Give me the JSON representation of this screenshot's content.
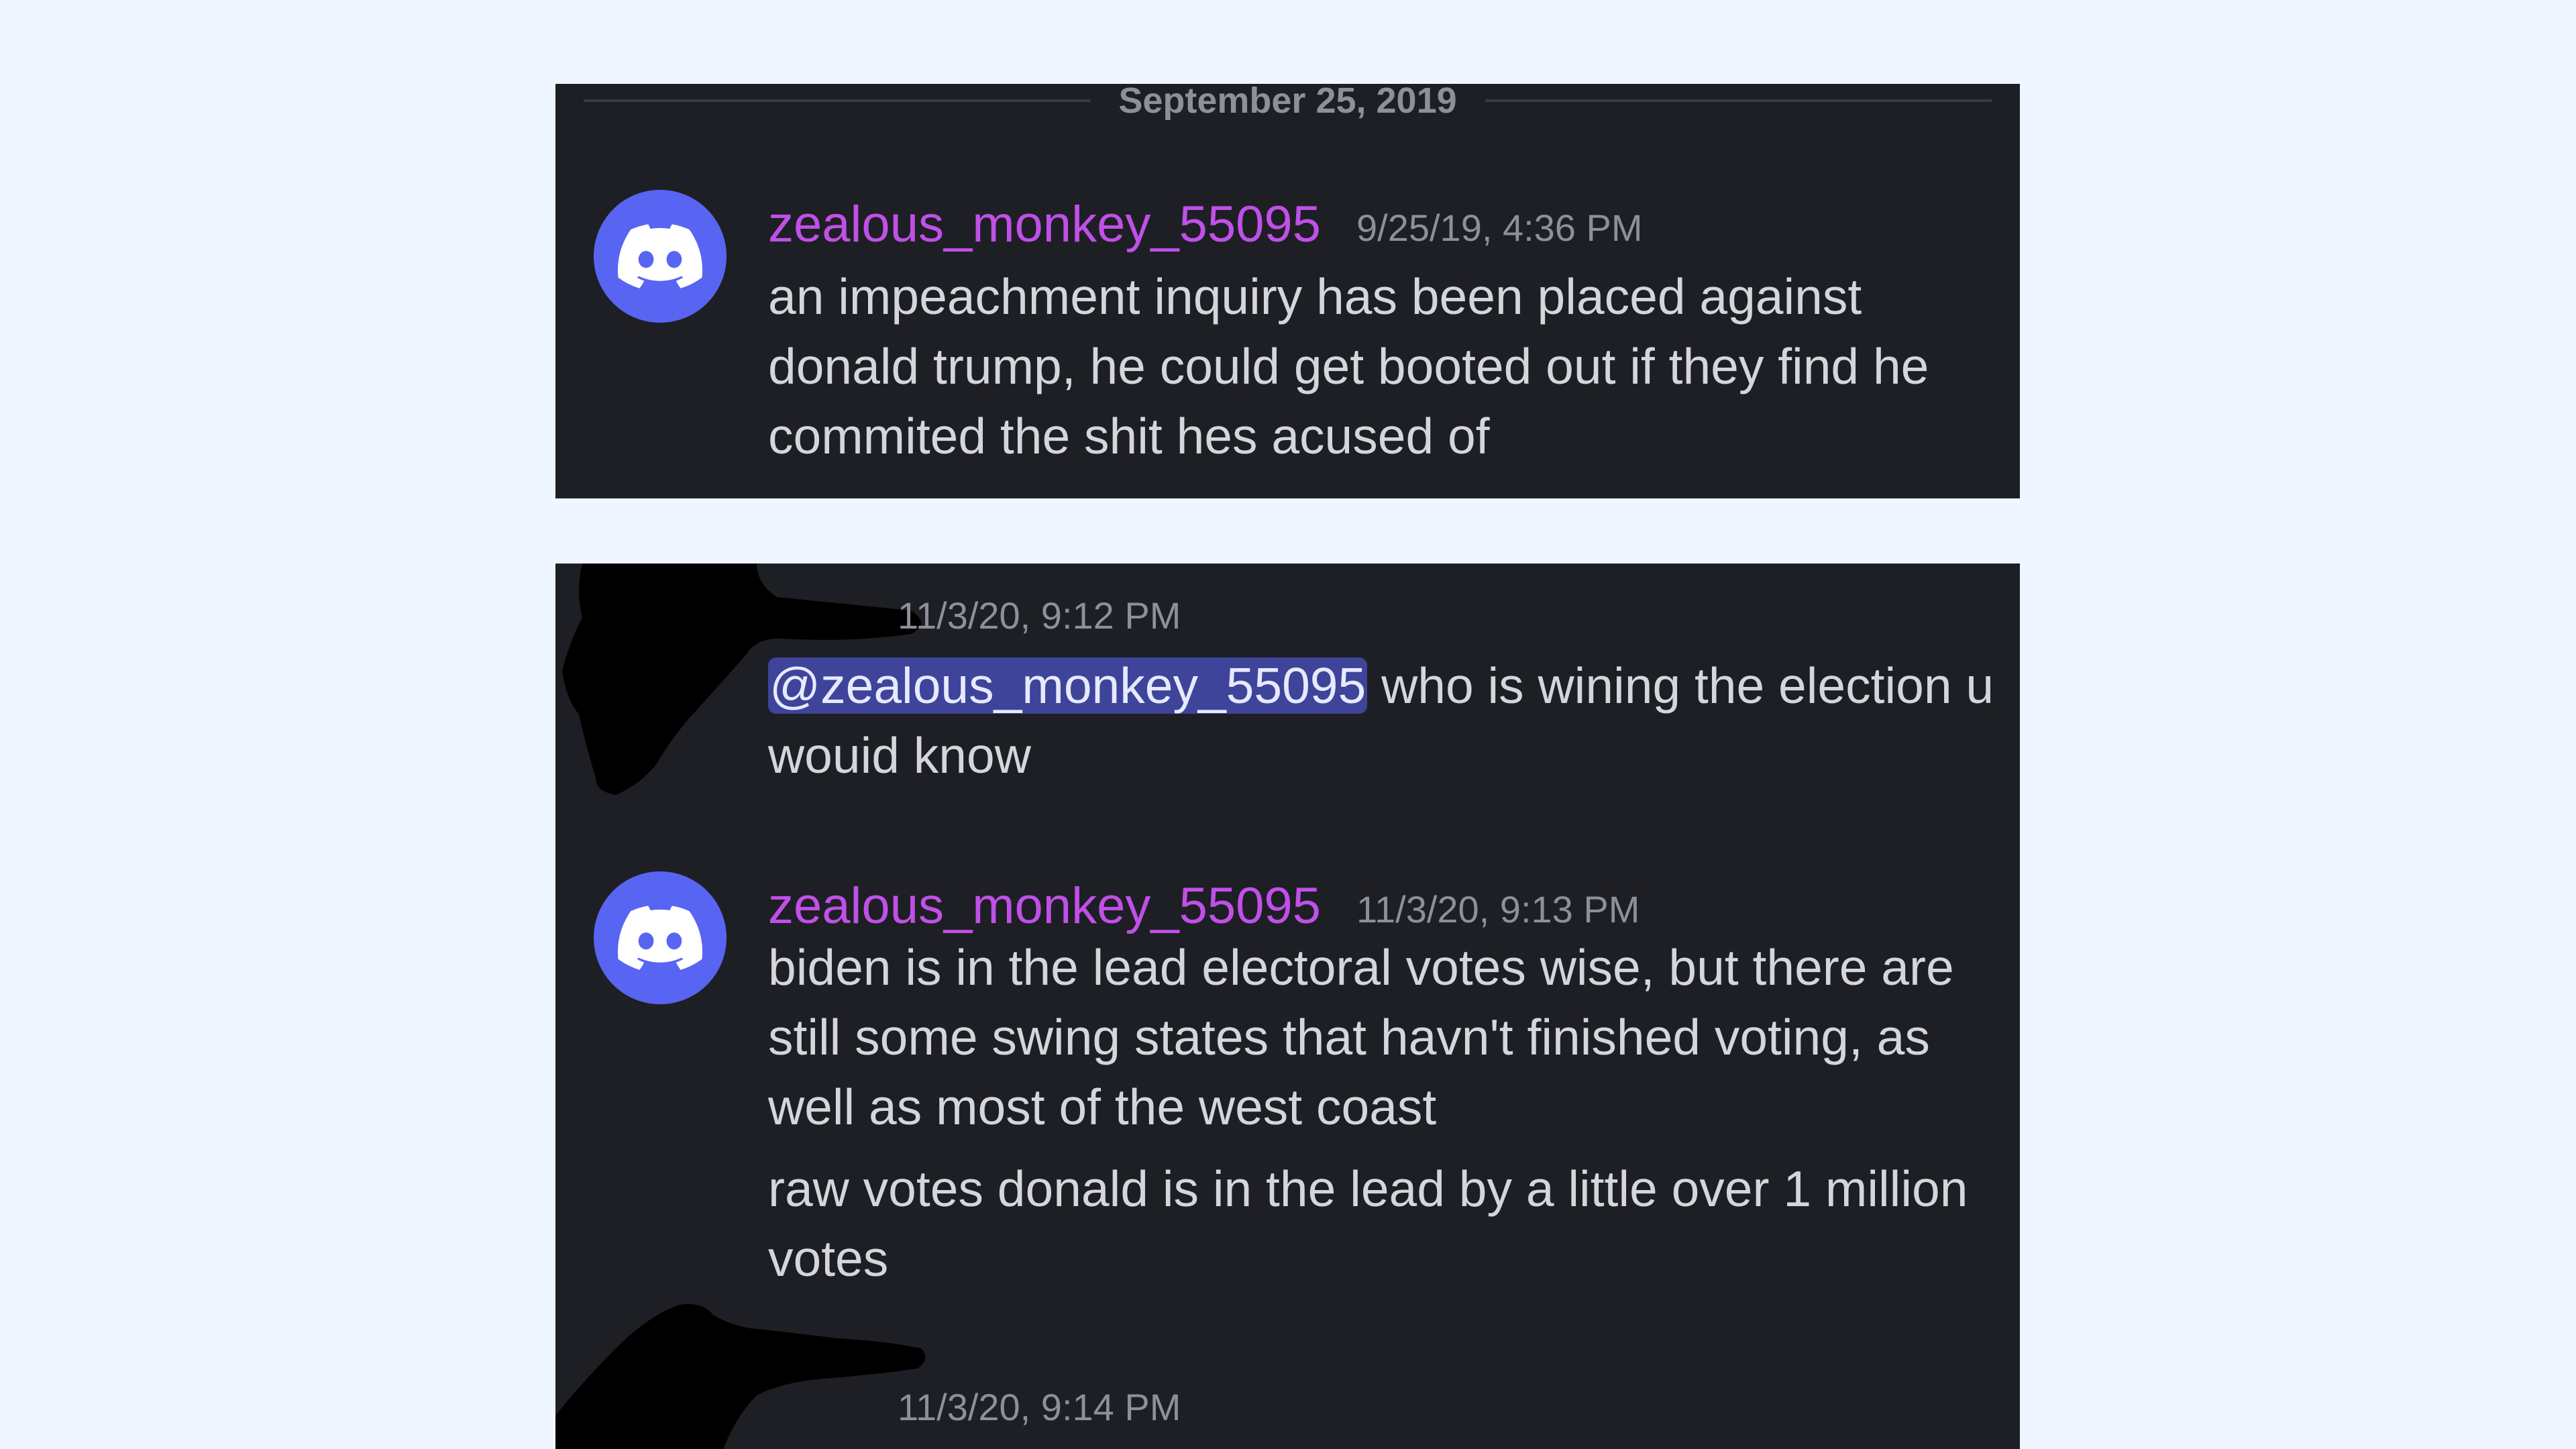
{
  "panel1": {
    "date_divider": "September 25, 2019",
    "message": {
      "username": "zealous_monkey_55095",
      "timestamp": "9/25/19, 4:36 PM",
      "text": "an impeachment inquiry has been placed against donald trump, he could get booted out if they find he commited the shit hes acused of",
      "avatar_icon": "discord-logo-icon"
    }
  },
  "panel2": {
    "messages": [
      {
        "author": "redacted",
        "timestamp": "11/3/20, 9:12 PM",
        "mention": "@zealous_monkey_55095",
        "text": " who is wining the election u wouid know"
      },
      {
        "username": "zealous_monkey_55095",
        "timestamp": "11/3/20, 9:13 PM",
        "text": "biden is in the lead electoral votes wise, but there are still some swing states that havn't finished voting, as well as most of the west coast",
        "avatar_icon": "discord-logo-icon"
      },
      {
        "continuation": true,
        "text": "raw votes donald is in the lead by a little over 1 million votes"
      },
      {
        "author": "redacted",
        "timestamp": "11/3/20, 9:14 PM"
      }
    ]
  },
  "colors": {
    "page_background": "#f0f6ff",
    "panel_background": "#1e1f24",
    "username": "#c050e8",
    "timestamp": "#8e9097",
    "message_text": "#d4d6dc",
    "avatar": "#5865f2",
    "mention_background": "#3d449a"
  }
}
